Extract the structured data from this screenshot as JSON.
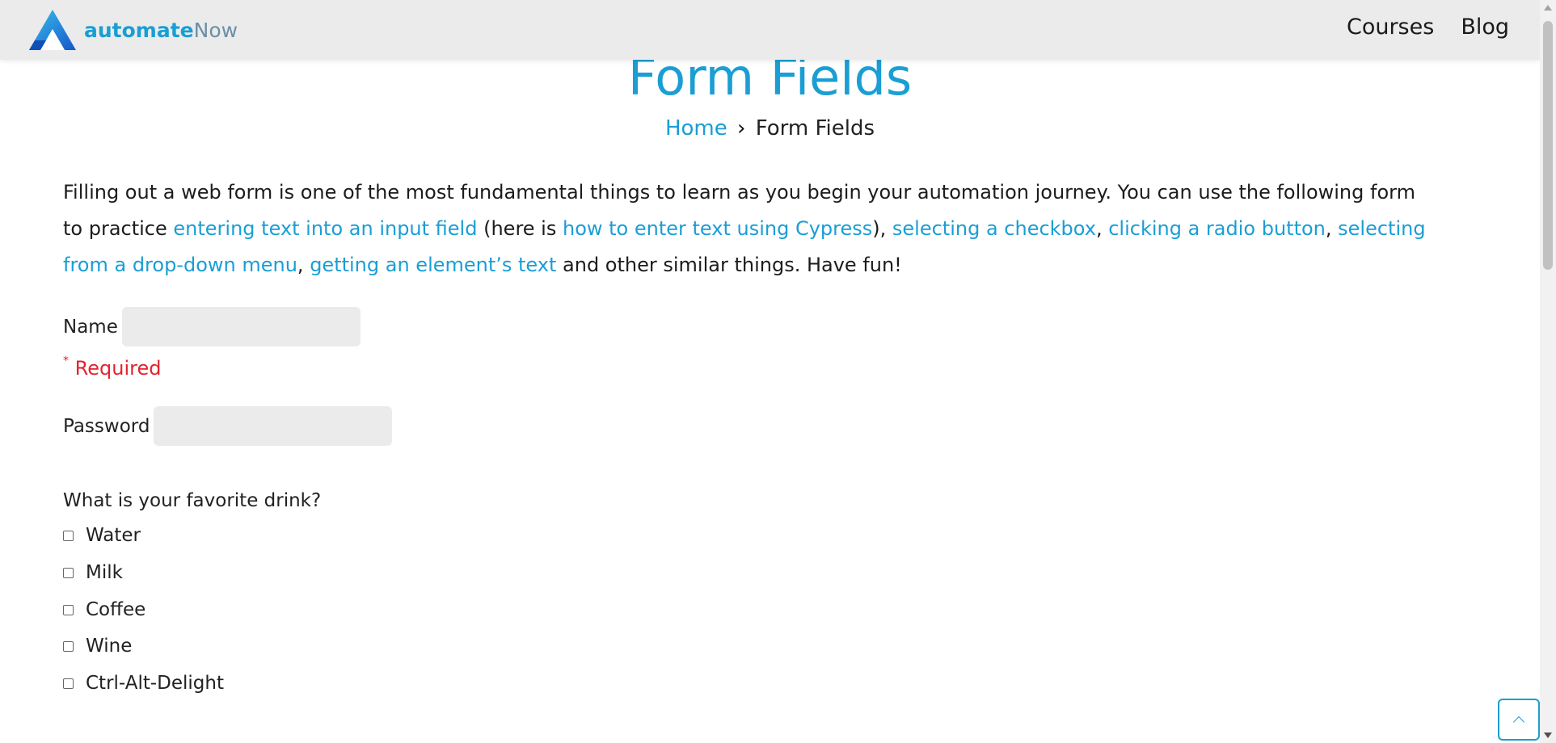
{
  "header": {
    "logo_main": "automate",
    "logo_accent": "Now",
    "nav": [
      {
        "label": "Courses"
      },
      {
        "label": "Blog"
      }
    ]
  },
  "page": {
    "title": "Form Fields",
    "breadcrumb": {
      "home": "Home",
      "separator": "›",
      "current": "Form Fields"
    }
  },
  "intro": {
    "t1": "Filling out a web form is one of the most fundamental things to learn as you begin your automation journey. You can use the following form to practice ",
    "l1": "entering text into an input field",
    "t2": " (here is ",
    "l2": "how to enter text using Cypress",
    "t3": "), ",
    "l3": "selecting a checkbox",
    "t4": ", ",
    "l4": "clicking a radio button",
    "t5": ", ",
    "l5": "selecting from a drop-down menu",
    "t6": ", ",
    "l6": "getting an element’s text",
    "t7": " and other similar things. Have fun!"
  },
  "form": {
    "name_label": "Name",
    "name_value": "",
    "required_star": "*",
    "required_text": " Required",
    "password_label": "Password",
    "password_value": "",
    "drink_question": "What is your favorite drink?",
    "drinks": [
      {
        "label": "Water",
        "checked": false
      },
      {
        "label": "Milk",
        "checked": false
      },
      {
        "label": "Coffee",
        "checked": false
      },
      {
        "label": "Wine",
        "checked": false
      },
      {
        "label": "Ctrl-Alt-Delight",
        "checked": false
      }
    ]
  },
  "colors": {
    "accent": "#1a9ed4",
    "required": "#e3232f",
    "header_bg": "#ebebeb",
    "input_bg": "#ebebeb"
  },
  "icons": {
    "logo": "automatenow-logo-icon",
    "back_to_top": "chevron-up-icon"
  }
}
